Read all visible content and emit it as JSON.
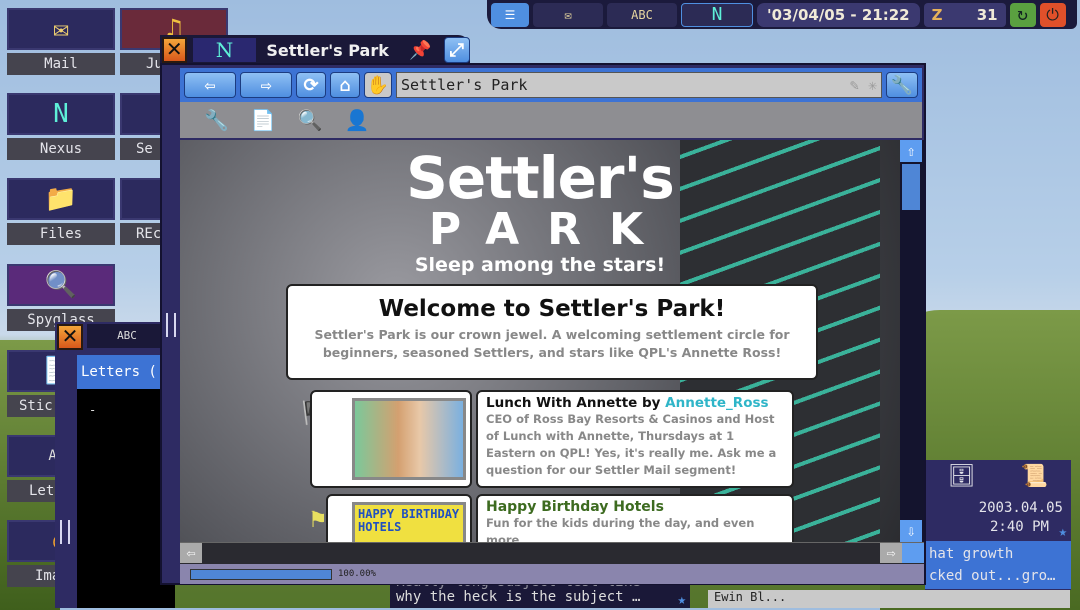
{
  "desktop": {
    "icons": [
      {
        "label": "Mail",
        "glyph": "✉"
      },
      {
        "label": "Nexus",
        "glyph": "N"
      },
      {
        "label": "Files",
        "glyph": "📁"
      },
      {
        "label": "Spyglass",
        "glyph": "🔍"
      },
      {
        "label": "Stic",
        "glyph": "📝"
      },
      {
        "label": "Let",
        "glyph": "ABC"
      },
      {
        "label": "Ima",
        "glyph": "◉"
      }
    ],
    "icons2": [
      {
        "label": "Ju",
        "glyph": "♫"
      },
      {
        "label": "Se",
        "glyph": "▭"
      },
      {
        "label": "REc",
        "glyph": "N"
      }
    ]
  },
  "taskbar": {
    "datetime": "'03/04/05 - 21:22",
    "z_label": "Z",
    "count": "31",
    "nexus": "N",
    "letters": "ABC"
  },
  "browser": {
    "title": "Settler's Park",
    "logo": "N",
    "address": "Settler's Park",
    "progress_percent": 100,
    "progress_label": "100.00%",
    "page": {
      "logo_line1": "Settler's",
      "logo_line2": "PARK",
      "tagline": "Sleep among the stars!",
      "welcome_title": "Welcome to Settler's Park!",
      "welcome_text": "Settler's Park is our crown jewel. A welcoming settlement circle for beginners, seasoned Settlers, and stars like QPL's Annette Ross!",
      "posts": [
        {
          "title": "Lunch With Annette by ",
          "author": "Annette_Ross",
          "text": "CEO of Ross Bay Resorts & Casinos and Host of Lunch with Annette, Thursdays at 1 Eastern on QPL! Yes, it's really me. Ask me a question for our Settler Mail segment!"
        },
        {
          "title": "Happy Birthday Hotels",
          "author": "",
          "text": "Fun for the kids during the day, and even more",
          "image_text": "HAPPY BIRTHDAY HOTELS"
        }
      ]
    }
  },
  "letters": {
    "title": "Letters (",
    "cursor": "-",
    "icon": "ABC"
  },
  "mail_preview": {
    "line1": "Really long subject test like",
    "line2": "why the heck is the subject …"
  },
  "side_panel": {
    "date": "2003.04.05",
    "time": "2:40 PM",
    "line1": "hat growth",
    "line2": "cked out...gro…"
  },
  "bottom_right": {
    "text": "Ewin Bl..."
  },
  "colors": {
    "accent": "#3d73d4",
    "author_link": "#2fb5c8",
    "post_title_green": "#3d6b20"
  }
}
